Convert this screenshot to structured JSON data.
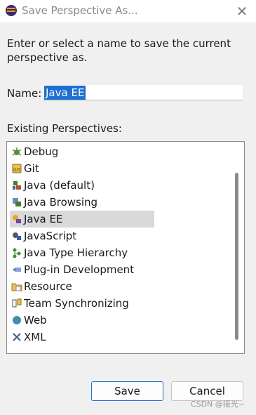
{
  "dialog": {
    "title": "Save Perspective As...",
    "close_label": "✕",
    "description": "Enter or select a name to save the current perspective as.",
    "name_label": "Name:",
    "name_value": "Java EE",
    "existing_label": "Existing Perspectives:",
    "perspectives": [
      {
        "label": "Debug",
        "icon": "debug-icon"
      },
      {
        "label": "Git",
        "icon": "git-icon"
      },
      {
        "label": "Java (default)",
        "icon": "java-icon"
      },
      {
        "label": "Java Browsing",
        "icon": "java-browsing-icon"
      },
      {
        "label": "Java EE",
        "icon": "java-ee-icon",
        "selected": true
      },
      {
        "label": "JavaScript",
        "icon": "javascript-icon"
      },
      {
        "label": "Java Type Hierarchy",
        "icon": "type-hierarchy-icon"
      },
      {
        "label": "Plug-in Development",
        "icon": "plugin-icon"
      },
      {
        "label": "Resource",
        "icon": "resource-icon"
      },
      {
        "label": "Team Synchronizing",
        "icon": "team-sync-icon"
      },
      {
        "label": "Web",
        "icon": "web-icon"
      },
      {
        "label": "XML",
        "icon": "xml-icon"
      }
    ],
    "save_label": "Save",
    "cancel_label": "Cancel"
  },
  "watermark": "CSDN @摇光~",
  "colors": {
    "selection": "#1e6fd0",
    "title_text": "#8a8a8a"
  }
}
